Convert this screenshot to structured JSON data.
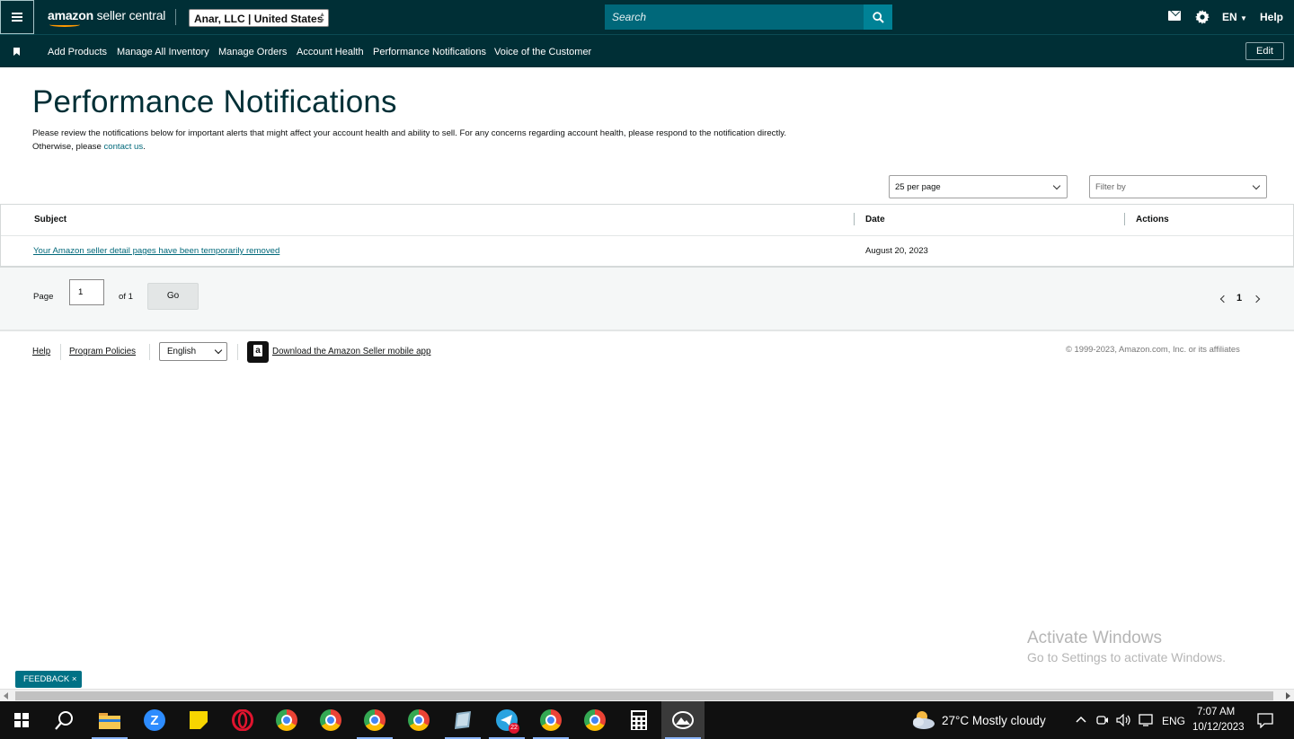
{
  "header": {
    "logo_bold": "amazon",
    "logo_text": " seller central",
    "account": "Anar, LLC | United States",
    "search_placeholder": "Search",
    "language": "EN",
    "help": "Help"
  },
  "nav": {
    "items": [
      {
        "label": "Add Products"
      },
      {
        "label": "Manage All Inventory"
      },
      {
        "label": "Manage Orders"
      },
      {
        "label": "Account Health"
      },
      {
        "label": "Performance Notifications"
      },
      {
        "label": "Voice of the Customer"
      }
    ],
    "edit": "Edit"
  },
  "page": {
    "title": "Performance Notifications",
    "desc_line1": "Please review the notifications below for important alerts that might affect your account health and ability to sell. For any concerns regarding account health, please respond to the notification directly.",
    "desc_line2_prefix": "Otherwise, please ",
    "desc_link": "contact us",
    "desc_line2_suffix": "."
  },
  "controls": {
    "per_page": "25 per page",
    "filter": "Filter by"
  },
  "table": {
    "headers": {
      "subject": "Subject",
      "date": "Date",
      "actions": "Actions"
    },
    "rows": [
      {
        "subject": "Your Amazon seller detail pages have been temporarily removed",
        "date": "August 20, 2023",
        "actions": ""
      }
    ]
  },
  "pagination": {
    "page_label": "Page",
    "page_value": "1",
    "of_label": "of 1",
    "go": "Go",
    "current": "1"
  },
  "footer": {
    "help": "Help",
    "policies": "Program Policies",
    "language": "English",
    "app": "Download the Amazon Seller mobile app",
    "copyright": "© 1999-2023, Amazon.com, Inc. or its affiliates"
  },
  "watermark": {
    "title": "Activate Windows",
    "subtitle": "Go to Settings to activate Windows."
  },
  "feedback": {
    "label": "FEEDBACK",
    "close": "×"
  },
  "taskbar": {
    "telegram_badge": "22",
    "weather": "27°C  Mostly cloudy",
    "lang": "ENG",
    "time": "7:07 AM",
    "date": "10/12/2023"
  },
  "colors": {
    "header_bg": "#002f36",
    "link": "#00687a",
    "search_bg": "#00687a",
    "feedback_bg": "#007185"
  }
}
